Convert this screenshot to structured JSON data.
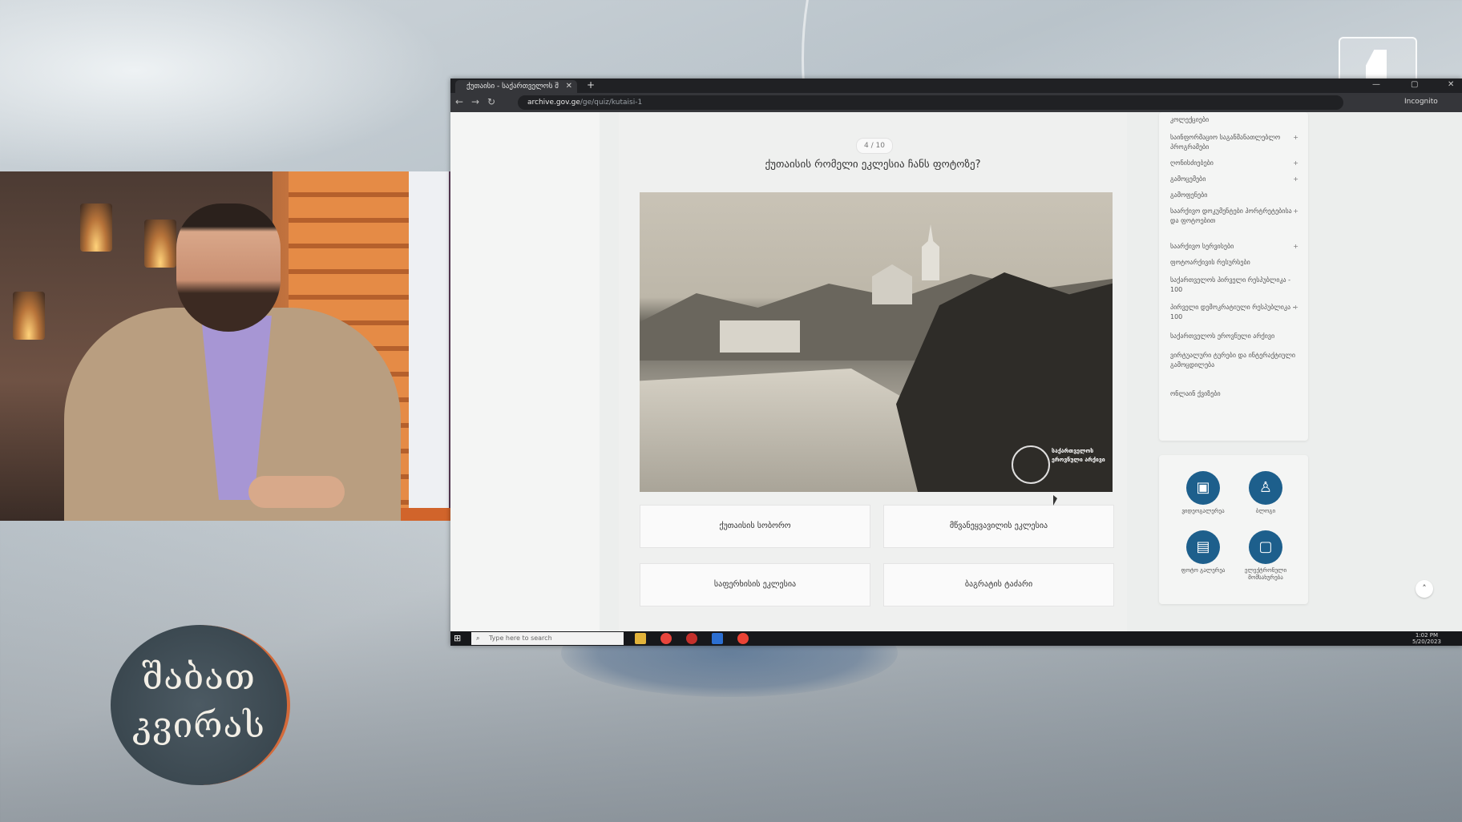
{
  "browser": {
    "tab_title": "ქუთაისი - საქართველოს შ",
    "url_host": "archive.gov.ge",
    "url_path": "/ge/quiz/kutaisi-1",
    "incognito_label": "Incognito"
  },
  "quiz": {
    "counter": "4 / 10",
    "question": "ქუთაისის რომელი ეკლესია ჩანს ფოტოზე?",
    "photo_stamp": "საქართველოს ეროვნული არქივი",
    "answers": [
      "ქუთაისის სობორო",
      "მწვანეყვავილის ეკლესია",
      "საფერხისის ეკლესია",
      "ბაგრატის ტაძარი"
    ]
  },
  "sidebar": {
    "items": [
      {
        "label": "კოლექციები",
        "plus": ""
      },
      {
        "label": "საინფორმაციო საგანმანათლებლო პროგრამები",
        "plus": "+"
      },
      {
        "label": "ღონისძიებები",
        "plus": "+"
      },
      {
        "label": "გამოცემები",
        "plus": "+"
      },
      {
        "label": "გამოფენები",
        "plus": ""
      },
      {
        "label": "საარქივო დოკუმენტები პორტრეტებისა და ფოტოებით",
        "plus": "+"
      },
      {
        "label": "საარქივო სერვისები",
        "plus": "+"
      },
      {
        "label": "ფოტოარქივის რესურსები",
        "plus": ""
      },
      {
        "label": "საქართველოს პირველი რესპუბლიკა - 100",
        "plus": ""
      },
      {
        "label": "პირველი დემოკრატიული რესპუბლიკა - 100",
        "plus": "+"
      },
      {
        "label": "საქართველოს ეროვნული არქივი",
        "plus": ""
      },
      {
        "label": "ვირტუალური ტურები და ინტერაქტიული გამოცდილება",
        "plus": ""
      },
      {
        "label": "ონლაინ ქვიზები",
        "plus": ""
      }
    ],
    "services": [
      {
        "icon": "video-icon",
        "glyph": "▣",
        "label": "ვიდეოგალერეა"
      },
      {
        "icon": "person-icon",
        "glyph": "♙",
        "label": "ბლოგი"
      },
      {
        "icon": "photo-icon",
        "glyph": "▤",
        "label": "ფოტო გალერეა"
      },
      {
        "icon": "monitor-icon",
        "glyph": "▢",
        "label": "ელექტრონული მომსახურება"
      }
    ],
    "scroll_top": "˄"
  },
  "taskbar": {
    "search_placeholder": "Type here to search",
    "time": "1:02 PM",
    "date": "5/20/2023",
    "apps": [
      "#e2b33a",
      "#e8453c",
      "#c4302b",
      "#2c6fd1",
      "#ea4335"
    ]
  },
  "show": {
    "logo_line_1": "შაბათ",
    "logo_line_2": "კვირას"
  },
  "colors": {
    "accent": "#1d5f8c",
    "logo_ring": "#d46a3a"
  }
}
